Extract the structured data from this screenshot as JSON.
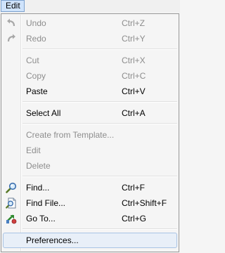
{
  "menubar": {
    "title": "Edit"
  },
  "menu": {
    "undo": {
      "label": "Undo",
      "shortcut": "Ctrl+Z"
    },
    "redo": {
      "label": "Redo",
      "shortcut": "Ctrl+Y"
    },
    "cut": {
      "label": "Cut",
      "shortcut": "Ctrl+X"
    },
    "copy": {
      "label": "Copy",
      "shortcut": "Ctrl+C"
    },
    "paste": {
      "label": "Paste",
      "shortcut": "Ctrl+V"
    },
    "select_all": {
      "label": "Select All",
      "shortcut": "Ctrl+A"
    },
    "create_from_template": {
      "label": "Create from Template..."
    },
    "edit": {
      "label": "Edit"
    },
    "delete": {
      "label": "Delete"
    },
    "find": {
      "label": "Find...",
      "shortcut": "Ctrl+F"
    },
    "find_file": {
      "label": "Find File...",
      "shortcut": "Ctrl+Shift+F"
    },
    "go_to": {
      "label": "Go To...",
      "shortcut": "Ctrl+G"
    },
    "preferences": {
      "label": "Preferences..."
    }
  },
  "icons": {
    "undo": "undo-icon",
    "redo": "redo-icon",
    "find": "magnifier-icon",
    "find_file": "find-file-icon",
    "go_to": "go-to-icon"
  }
}
